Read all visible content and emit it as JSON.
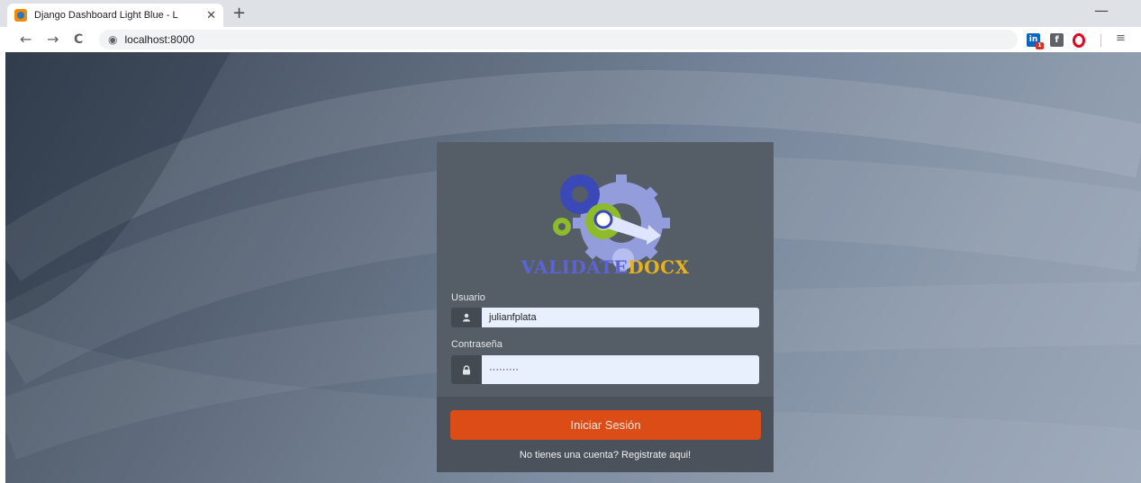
{
  "browser": {
    "tab_title": "Django Dashboard Light Blue - L",
    "tab_close": "✕",
    "new_tab": "+",
    "minimize": "—",
    "back": "←",
    "forward": "→",
    "reload": "C",
    "url": "localhost:8000",
    "extensions": {
      "linkedin": "in",
      "linkedin_badge": "1",
      "facebook": "f",
      "menu": "≡"
    }
  },
  "login": {
    "brand_validate": "VALIDATE",
    "brand_docx": "DOCX",
    "username_label": "Usuario",
    "username_value": "julianfplata",
    "password_label": "Contraseña",
    "password_value": "·········",
    "submit_label": "Iniciar Sesión",
    "register_text": "No tienes una cuenta? Registrate aqui!"
  },
  "colors": {
    "card": "#555d67",
    "button": "#db4c17",
    "brand_blue": "#5b63d6",
    "brand_gold": "#e8b21d"
  }
}
